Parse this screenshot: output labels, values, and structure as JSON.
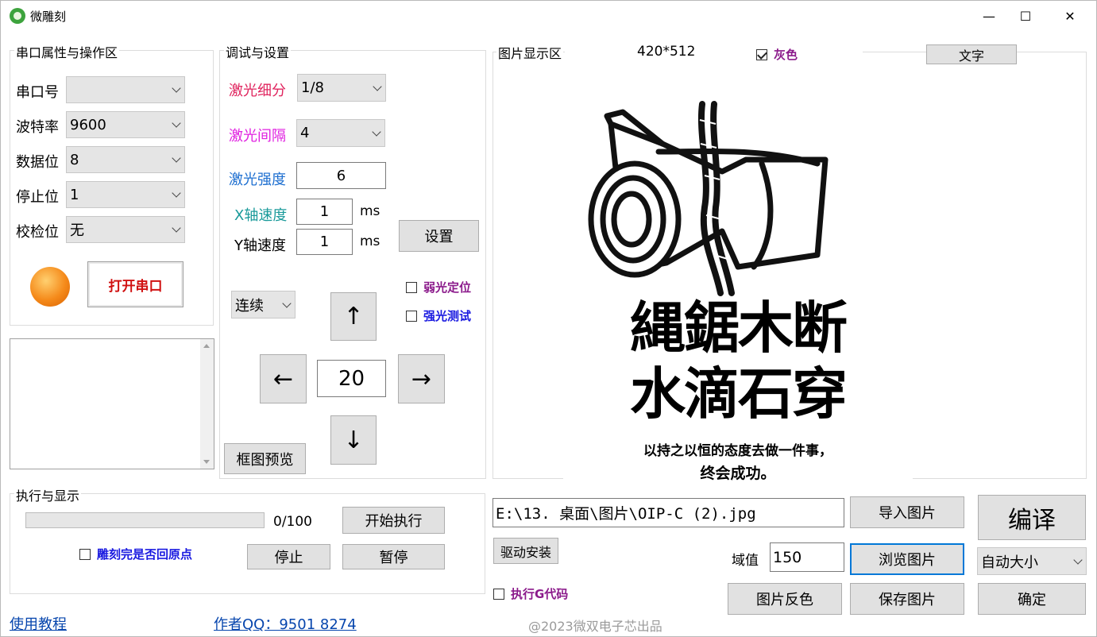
{
  "window": {
    "title": "微雕刻",
    "minimize": "—",
    "maximize": "☐",
    "close": "✕"
  },
  "serial": {
    "title": "串口属性与操作区",
    "fields": [
      {
        "label": "串口号",
        "value": ""
      },
      {
        "label": "波特率",
        "value": "9600"
      },
      {
        "label": "数据位",
        "value": "8"
      },
      {
        "label": "停止位",
        "value": "1"
      },
      {
        "label": "校检位",
        "value": "无"
      }
    ],
    "open_button": "打开串口",
    "status_color": "#f58a1a"
  },
  "debug": {
    "title": "调试与设置",
    "subdivision_label": "激光细分",
    "subdivision_value": "1/8",
    "interval_label": "激光间隔",
    "interval_value": "4",
    "strength_label": "激光强度",
    "strength_value": "6",
    "x_speed_label": "X轴速度",
    "x_speed_value": "1",
    "y_speed_label": "Y轴速度",
    "y_speed_value": "1",
    "unit": "ms",
    "set_button": "设置",
    "weak_locate": "弱光定位",
    "strong_test": "强光测试",
    "mode_value": "连续",
    "step_value": "20",
    "up": "↑",
    "down": "↓",
    "left": "←",
    "right": "→",
    "preview_button": "框图预览",
    "colors": {
      "subdivision": "#e0245e",
      "interval": "#e020e0",
      "strength": "#1e6fd0",
      "x_speed": "#1a9a9a"
    }
  },
  "image": {
    "title": "图片显示区",
    "size": "420*512",
    "gray_label": "灰色",
    "gray_checked": true,
    "text_button": "文字",
    "art": {
      "line1": "縄鋸木断",
      "line2": "水滴石穿",
      "caption1": "以持之以恒的态度去做一件事，",
      "caption2": "终会成功。"
    }
  },
  "exec": {
    "title": "执行与显示",
    "progress_text": "0/100",
    "progress": 0,
    "start_button": "开始执行",
    "return_origin": "雕刻完是否回原点",
    "stop_button": "停止",
    "pause_button": "暂停"
  },
  "bottom": {
    "path_value": "E:\\13. 桌面\\图片\\OIP-C (2).jpg",
    "import_button": "导入图片",
    "compile_button": "编译",
    "driver_button": "驱动安装",
    "threshold_label": "域值",
    "threshold_value": "150",
    "browse_button": "浏览图片",
    "size_value": "自动大小",
    "gcode_label": "执行G代码",
    "invert_button": "图片反色",
    "save_button": "保存图片",
    "confirm_button": "确定",
    "tutorial_link": "使用教程",
    "author_link": "作者QQ：9501 8274",
    "watermark": "@2023微双电子芯出品"
  }
}
